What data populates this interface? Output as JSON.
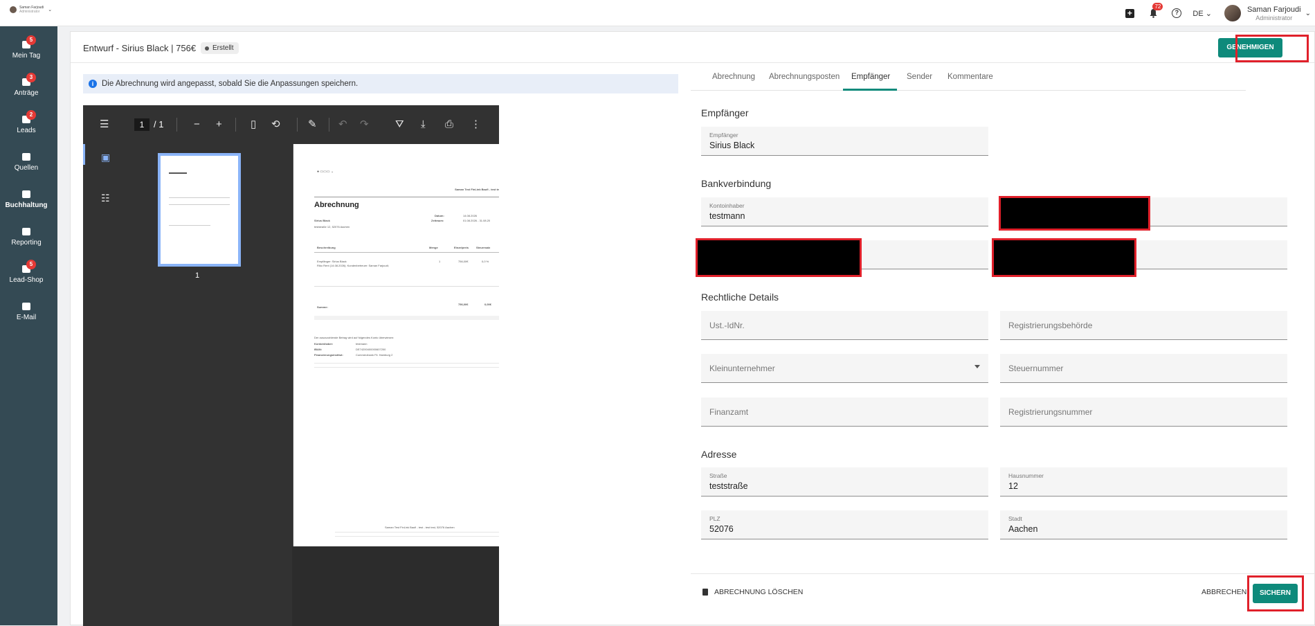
{
  "topbar": {
    "small_user_name": "Saman Farjoudi",
    "small_user_role": "Administrator",
    "notification_count": "72",
    "language": "DE",
    "user_name": "Saman Farjoudi",
    "user_role": "Administrator"
  },
  "sidebar": {
    "items": [
      {
        "label": "Mein Tag",
        "badge": "5",
        "icon": "dashboard-icon"
      },
      {
        "label": "Anträge",
        "badge": "3",
        "icon": "users-icon"
      },
      {
        "label": "Leads",
        "badge": "2",
        "icon": "person-icon"
      },
      {
        "label": "Quellen",
        "badge": "",
        "icon": "id-card-icon"
      },
      {
        "label": "Buchhaltung",
        "badge": "",
        "icon": "wallet-icon"
      },
      {
        "label": "Reporting",
        "badge": "",
        "icon": "chart-icon"
      },
      {
        "label": "Lead-Shop",
        "badge": "5",
        "icon": "shop-icon"
      },
      {
        "label": "E-Mail",
        "badge": "",
        "icon": "mail-icon"
      }
    ]
  },
  "header": {
    "title": "Entwurf - Sirius Black | 756€",
    "status": "Erstellt",
    "approve_label": "GENEHMIGEN"
  },
  "info": {
    "text": "Die Abrechnung wird angepasst, sobald Sie die Anpassungen speichern."
  },
  "viewer": {
    "page_current": "1",
    "page_total": "/ 1",
    "thumb_number": "1",
    "doc": {
      "company": "Saman Test FinLink Baufi - test te",
      "heading": "Abrechnung",
      "recipient": "Sirius Black",
      "street": "teststraße 12, 52076 Aachen",
      "datum_label": "Datum:",
      "datum": "14.08.2026",
      "zeitraum_label": "Zeitraum:",
      "zeitraum": "01.08.2026 - 31.08.20",
      "col_desc": "Beschreibung",
      "col_qty": "Menge",
      "col_price": "Einzelpreis",
      "col_tax": "Steuersatz",
      "item_line1": "Empfänger: Sirius Black",
      "item_line2": "Riko Rent (14.08.2026); Kundenbetreuer: Saman Farjoudi;",
      "item_qty": "1",
      "item_price": "756,00€",
      "item_tax": "0,0 %",
      "sum_label": "Summe:",
      "sum_value": "756,00€",
      "sum_tax": "0,00€",
      "transfer_text": "Der auszuzahlende Betrag wird auf folgendes Konto überwiesen:",
      "holder_label": "Kontoinhaber:",
      "holder": "testmann",
      "iban_label": "IBAN:",
      "iban": "DE74200400000607200",
      "bank_label": "Finanzierungsinstitut:",
      "bank": "Commerzbank Fil. Hamburg 2",
      "footer1": "Saman Test FinLink Baufi - test - test test, 52076 Aachen"
    }
  },
  "tabs": [
    {
      "label": "Abrechnung"
    },
    {
      "label": "Abrechnungsposten"
    },
    {
      "label": "Empfänger"
    },
    {
      "label": "Sender"
    },
    {
      "label": "Kommentare"
    }
  ],
  "form": {
    "empfaenger_title": "Empfänger",
    "empfaenger": {
      "label": "Empfänger",
      "value": "Sirius Black"
    },
    "bank_title": "Bankverbindung",
    "kontoinhaber": {
      "label": "Kontoinhaber",
      "value": "testmann"
    },
    "legal_title": "Rechtliche Details",
    "ust_id": "Ust.-IdNr.",
    "registrierungsbehoerde": "Registrierungsbehörde",
    "kleinunternehmer": "Kleinunternehmer",
    "steuernummer": "Steuernummer",
    "finanzamt": "Finanzamt",
    "registrierungsnummer": "Registrierungsnummer",
    "address_title": "Adresse",
    "strasse": {
      "label": "Straße",
      "value": "teststraße"
    },
    "hausnummer": {
      "label": "Hausnummer",
      "value": "12"
    },
    "plz": {
      "label": "PLZ",
      "value": "52076"
    },
    "stadt": {
      "label": "Stadt",
      "value": "Aachen"
    }
  },
  "footer": {
    "delete_label": "ABRECHNUNG LÖSCHEN",
    "cancel_label": "ABBRECHEN",
    "save_label": "SICHERN"
  },
  "colors": {
    "accent": "#0e8a7b",
    "sidebar": "#344a54",
    "badge": "#e53935",
    "highlight": "#e0202a"
  }
}
